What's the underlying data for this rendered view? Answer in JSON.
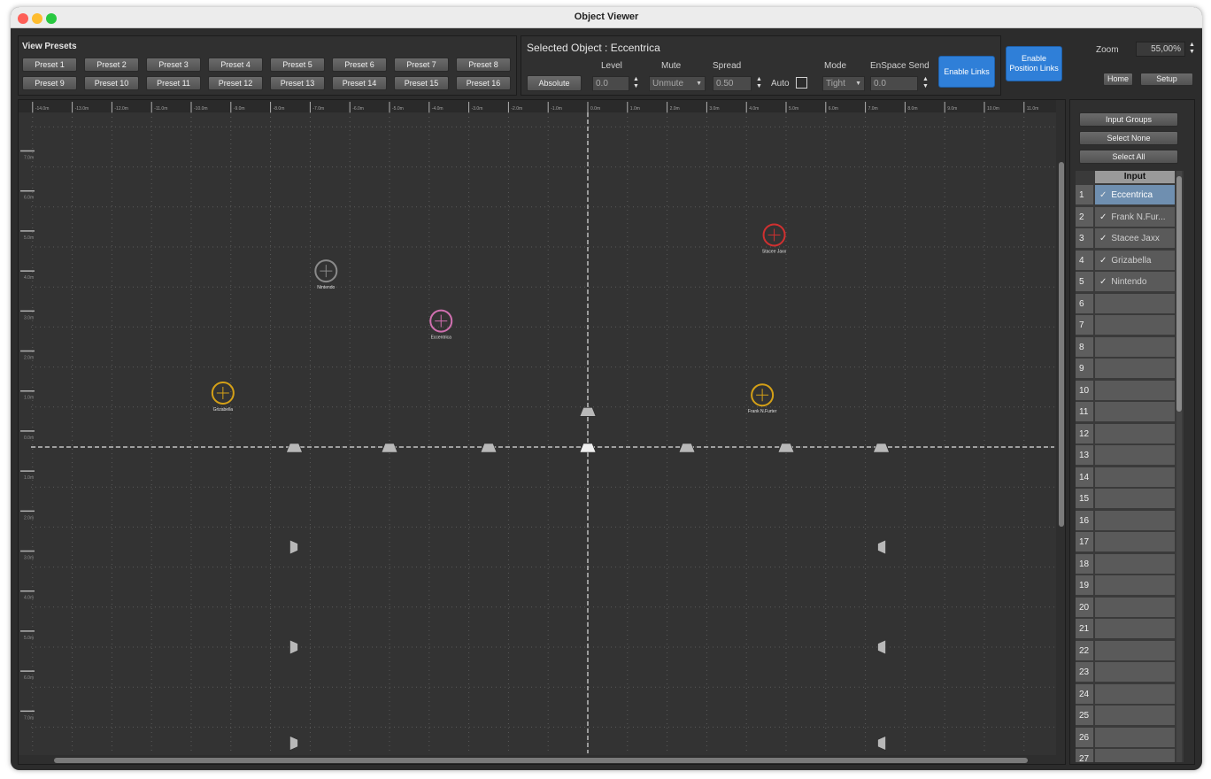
{
  "window": {
    "title": "Object Viewer"
  },
  "presets": {
    "title": "View Presets",
    "items": [
      "Preset 1",
      "Preset 2",
      "Preset 3",
      "Preset 4",
      "Preset 5",
      "Preset 6",
      "Preset 7",
      "Preset 8",
      "Preset 9",
      "Preset 10",
      "Preset 11",
      "Preset 12",
      "Preset 13",
      "Preset 14",
      "Preset 15",
      "Preset 16"
    ]
  },
  "selected": {
    "title": "Selected Object : Eccentrica",
    "absolute_label": "Absolute",
    "level_label": "Level",
    "level_value": "0.0",
    "mute_label": "Mute",
    "mute_value": "Unmute",
    "spread_label": "Spread",
    "spread_value": "0.50",
    "auto_label": "Auto",
    "auto_checked": false,
    "mode_label": "Mode",
    "mode_value": "Tight",
    "enspace_label": "EnSpace Send",
    "enspace_value": "0.0",
    "enable_links_label": "Enable Links",
    "enable_position_links_label": "Enable Position Links"
  },
  "zoom": {
    "label": "Zoom",
    "value": "55,00%"
  },
  "nav": {
    "home_label": "Home",
    "setup_label": "Setup"
  },
  "side": {
    "input_groups_label": "Input Groups",
    "select_none_label": "Select None",
    "select_all_label": "Select All",
    "column_header": "Input",
    "rows": [
      {
        "num": "1",
        "name": "Eccentrica",
        "checked": true,
        "selected": true
      },
      {
        "num": "2",
        "name": "Frank N.Fur...",
        "checked": true
      },
      {
        "num": "3",
        "name": "Stacee Jaxx",
        "checked": true
      },
      {
        "num": "4",
        "name": "Grizabella",
        "checked": true
      },
      {
        "num": "5",
        "name": "Nintendo",
        "checked": true
      },
      {
        "num": "6",
        "name": ""
      },
      {
        "num": "7",
        "name": ""
      },
      {
        "num": "8",
        "name": ""
      },
      {
        "num": "9",
        "name": ""
      },
      {
        "num": "10",
        "name": ""
      },
      {
        "num": "11",
        "name": ""
      },
      {
        "num": "12",
        "name": ""
      },
      {
        "num": "13",
        "name": ""
      },
      {
        "num": "14",
        "name": ""
      },
      {
        "num": "15",
        "name": ""
      },
      {
        "num": "16",
        "name": ""
      },
      {
        "num": "17",
        "name": ""
      },
      {
        "num": "18",
        "name": ""
      },
      {
        "num": "19",
        "name": ""
      },
      {
        "num": "20",
        "name": ""
      },
      {
        "num": "21",
        "name": ""
      },
      {
        "num": "22",
        "name": ""
      },
      {
        "num": "23",
        "name": ""
      },
      {
        "num": "24",
        "name": ""
      },
      {
        "num": "25",
        "name": ""
      },
      {
        "num": "26",
        "name": ""
      },
      {
        "num": "27",
        "name": ""
      }
    ]
  },
  "viewer": {
    "ruler_labels": [
      "-14.0m",
      "-13.0m",
      "-12.0m",
      "-11.0m",
      "-10.0m",
      "-9.0m",
      "-8.0m",
      "-7.0m",
      "-6.0m",
      "-5.0m",
      "-4.0m",
      "-3.0m",
      "-2.0m",
      "-1.0m",
      "0.0m",
      "1.0m",
      "2.0m",
      "3.0m",
      "4.0m",
      "5.0m",
      "6.0m",
      "7.0m",
      "8.0m",
      "9.0m",
      "10.0m",
      "11.0m"
    ],
    "y_ruler_labels": [
      "8.0m",
      "7.0m",
      "6.0m",
      "5.0m",
      "4.0m",
      "3.0m",
      "2.0m",
      "1.0m",
      "0.0m",
      "1.0m",
      "2.0m",
      "3.0m",
      "4.0m",
      "5.0m",
      "6.0m",
      "7.0m"
    ],
    "objects": [
      {
        "name": "Nintendo",
        "x": -6.6,
        "y": 4.4,
        "color": "#8a8a8a"
      },
      {
        "name": "Eccentrica",
        "x": -3.7,
        "y": 3.15,
        "color": "#d070b0"
      },
      {
        "name": "Grizabella",
        "x": -9.2,
        "y": 1.35,
        "color": "#d4a017"
      },
      {
        "name": "Stacee Jaxx",
        "x": 4.7,
        "y": 5.3,
        "color": "#d03030"
      },
      {
        "name": "Frank N.Furter",
        "x": 4.4,
        "y": 1.3,
        "color": "#d4a017"
      }
    ],
    "speakers": [
      {
        "x": 0.0,
        "y": 0.9,
        "dir": "down"
      },
      {
        "x": -7.4,
        "y": 0.0,
        "dir": "down"
      },
      {
        "x": -5.0,
        "y": 0.0,
        "dir": "down"
      },
      {
        "x": -2.5,
        "y": 0.0,
        "dir": "down"
      },
      {
        "x": 0.0,
        "y": 0.0,
        "dir": "down",
        "main": true
      },
      {
        "x": 2.5,
        "y": 0.0,
        "dir": "down"
      },
      {
        "x": 5.0,
        "y": 0.0,
        "dir": "down"
      },
      {
        "x": 7.4,
        "y": 0.0,
        "dir": "down"
      },
      {
        "x": -7.4,
        "y": -2.5,
        "dir": "right"
      },
      {
        "x": 7.4,
        "y": -2.5,
        "dir": "left"
      },
      {
        "x": -7.4,
        "y": -5.0,
        "dir": "right"
      },
      {
        "x": 7.4,
        "y": -5.0,
        "dir": "left"
      },
      {
        "x": -7.4,
        "y": -7.4,
        "dir": "right"
      },
      {
        "x": 7.4,
        "y": -7.4,
        "dir": "left"
      }
    ]
  }
}
